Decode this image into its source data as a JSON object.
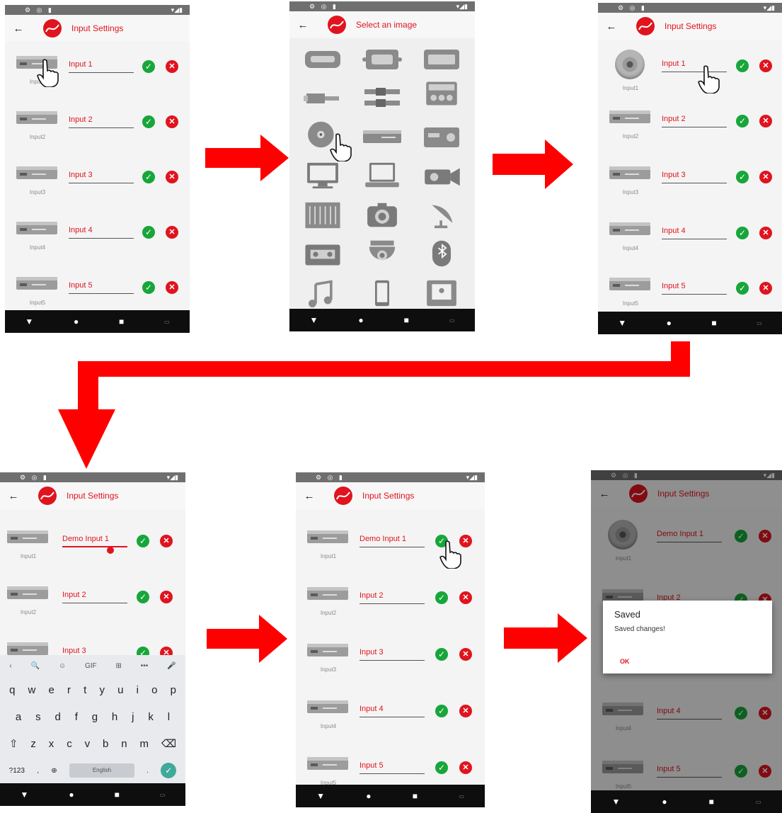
{
  "status_icons_left": "⚙ ◎ ▮",
  "status_icons_right": "▾◢▮",
  "screens": {
    "s1": {
      "title": "Input Settings",
      "inputs": [
        "Input 1",
        "Input 2",
        "Input 3",
        "Input 4",
        "Input 5"
      ],
      "labels": [
        "Input1",
        "Input2",
        "Input3",
        "Input4",
        "Input5"
      ]
    },
    "s2": {
      "title": "Select an image"
    },
    "s3": {
      "title": "Input Settings",
      "inputs": [
        "Input 1",
        "Input 2",
        "Input 3",
        "Input 4",
        "Input 5"
      ],
      "labels": [
        "Input1",
        "Input2",
        "Input3",
        "Input4",
        "Input5"
      ]
    },
    "s4": {
      "title": "Input Settings",
      "inputs": [
        "Demo Input 1",
        "Input 2",
        "Input 3"
      ],
      "labels": [
        "Input1",
        "Input2"
      ]
    },
    "s5": {
      "title": "Input Settings",
      "inputs": [
        "Demo Input 1",
        "Input 2",
        "Input 3",
        "Input 4",
        "Input 5"
      ],
      "labels": [
        "Input1",
        "Input2",
        "Input3",
        "Input4",
        "Input5"
      ]
    },
    "s6": {
      "title": "Input Settings",
      "inputs": [
        "Demo Input 1",
        "Input 2",
        "Input 4",
        "Input 5"
      ],
      "labels": [
        "Input1",
        "Input4",
        "Input5"
      ]
    }
  },
  "keyboard": {
    "row1": [
      "q",
      "w",
      "e",
      "r",
      "t",
      "y",
      "u",
      "i",
      "o",
      "p"
    ],
    "row2": [
      "a",
      "s",
      "d",
      "f",
      "g",
      "h",
      "j",
      "k",
      "l"
    ],
    "row3": [
      "⇧",
      "z",
      "x",
      "c",
      "v",
      "b",
      "n",
      "m",
      "⌫"
    ],
    "suggest": [
      "‹",
      "🔍",
      "☺",
      "GIF",
      "⊞",
      "•••",
      "🎤"
    ],
    "symbols": "?123",
    "space": "English",
    "period": "."
  },
  "dialog": {
    "title": "Saved",
    "message": "Saved changes!",
    "ok": "OK"
  },
  "colors": {
    "brand_red": "#e0141e",
    "ok_green": "#17a63a",
    "arrow_red": "#ff0000"
  }
}
